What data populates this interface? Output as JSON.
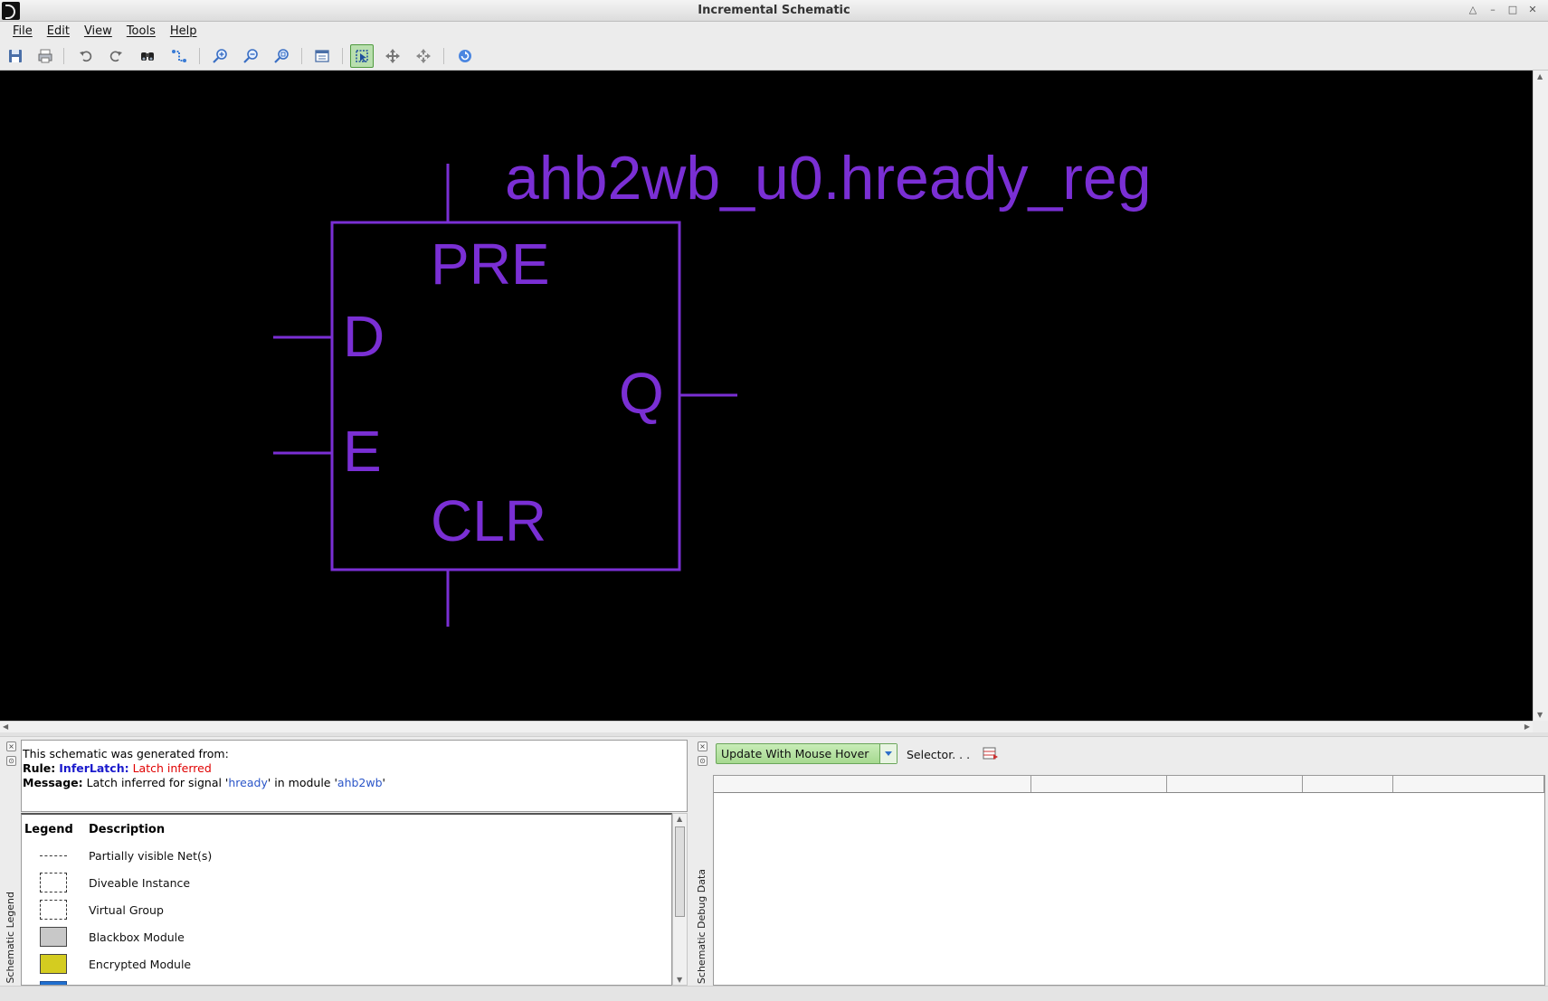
{
  "window": {
    "title": "Incremental Schematic",
    "controls": [
      "arrow-up-icon",
      "minimize-icon",
      "maximize-icon",
      "close-icon"
    ]
  },
  "menubar": {
    "items": [
      "File",
      "Edit",
      "View",
      "Tools",
      "Help"
    ]
  },
  "toolbar": {
    "buttons": [
      "save-icon",
      "print-icon",
      "undo-icon",
      "redo-icon",
      "find-icon",
      "trace-icon",
      "zoom-in-icon",
      "zoom-out-icon",
      "zoom-fit-icon",
      "properties-icon",
      "select-mode-icon",
      "pan-icon",
      "move-icon",
      "refresh-icon"
    ],
    "active_button": "select-mode-icon"
  },
  "schematic": {
    "instance_name": "ahb2wb_u0.hready_reg",
    "pins": {
      "preset": "PRE",
      "data": "D",
      "enable": "E",
      "output": "Q",
      "clear": "CLR"
    },
    "colors": {
      "background": "#000000",
      "symbol": "#7a2fd4"
    }
  },
  "legend_panel": {
    "tab_label": "Schematic Legend",
    "info": {
      "intro": "This schematic was generated from:",
      "rule_label": "Rule:",
      "rule_name": "InferLatch:",
      "rule_text": "Latch inferred",
      "message_label": "Message:",
      "message_prefix": "Latch inferred for signal '",
      "signal": "hready",
      "message_mid": "' in module '",
      "module": "ahb2wb",
      "message_suffix": "'"
    },
    "headers": {
      "legend": "Legend",
      "description": "Description"
    },
    "rows": [
      {
        "description": "Partially visible Net(s)",
        "swatch": "dashed-line"
      },
      {
        "description": "Diveable Instance",
        "swatch": "dashed-box"
      },
      {
        "description": "Virtual Group",
        "swatch": "dashed-box"
      },
      {
        "description": "Blackbox Module",
        "swatch": "filled",
        "color": "#c8c8c8"
      },
      {
        "description": "Encrypted Module",
        "swatch": "filled",
        "color": "#d4cc20"
      },
      {
        "description": "",
        "swatch": "filled",
        "color": "#1f6fd0"
      }
    ]
  },
  "debug_panel": {
    "tab_label": "Schematic Debug Data",
    "mode_dropdown": "Update With Mouse Hover",
    "selector_label": "Selector. . ."
  }
}
